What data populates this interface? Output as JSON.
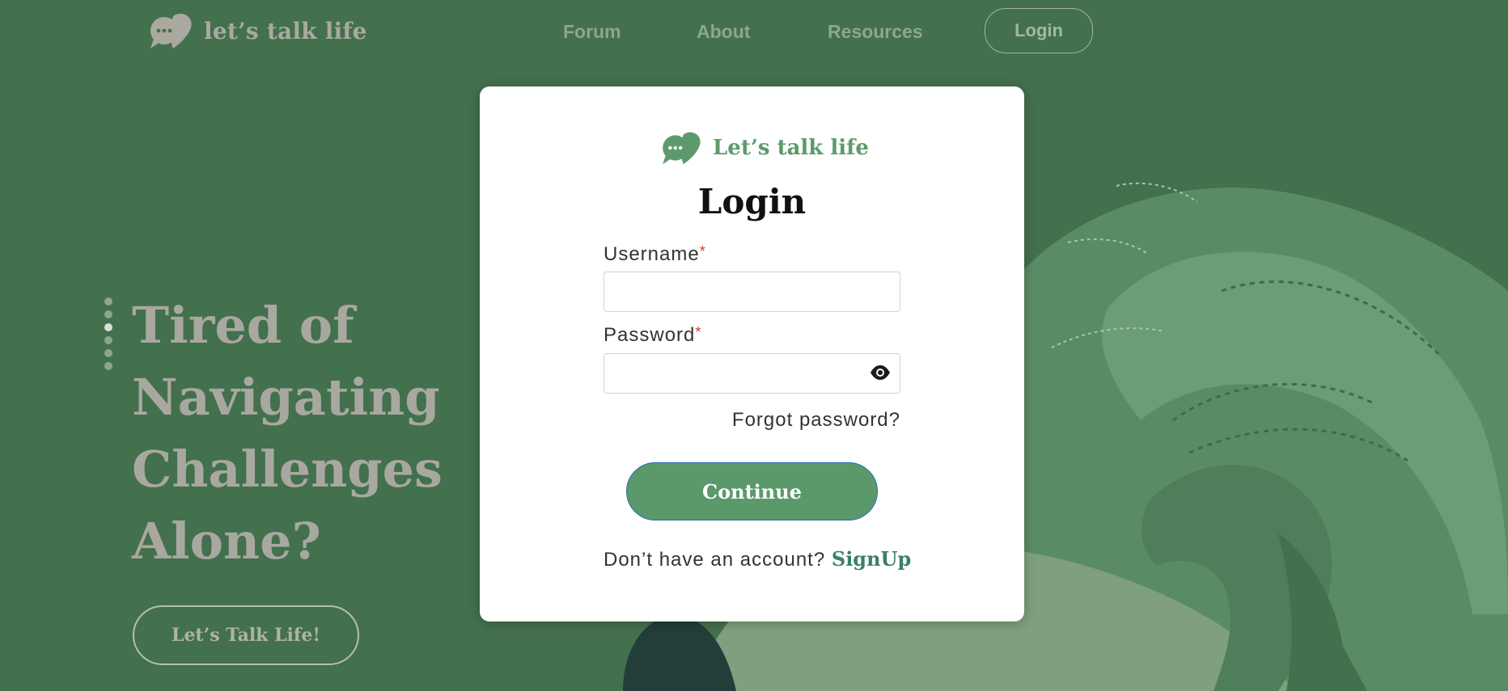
{
  "brand": {
    "name": "let’s talk life",
    "modal_name": "Let’s talk life"
  },
  "nav": {
    "items": [
      "Forum",
      "About",
      "Resources"
    ],
    "login": "Login"
  },
  "hero": {
    "title": "Tired of\nNavigating\nChallenges Alone?",
    "cta": "Let’s Talk Life!",
    "slide_count": 6,
    "active_slide": 3
  },
  "login_modal": {
    "title": "Login",
    "username_label": "Username",
    "password_label": "Password",
    "required_mark": "*",
    "username_value": "",
    "password_value": "",
    "forgot": "Forgot password?",
    "continue": "Continue",
    "no_account": "Don’t have an account?",
    "signup": "SignUp"
  },
  "colors": {
    "background": "#41694a",
    "brand_green": "#5b996b",
    "link_green": "#3c7f66",
    "required_red": "#d23a2e"
  }
}
